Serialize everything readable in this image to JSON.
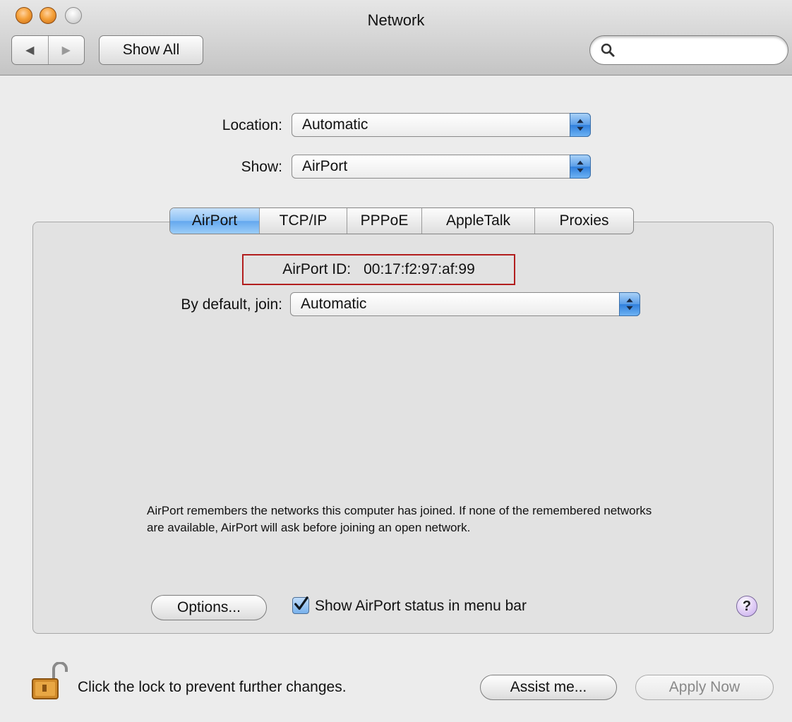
{
  "window": {
    "title": "Network"
  },
  "toolbar": {
    "back_icon": "back-arrow-icon",
    "forward_icon": "forward-arrow-icon",
    "show_all_label": "Show All",
    "search_placeholder": ""
  },
  "location": {
    "label": "Location:",
    "value": "Automatic"
  },
  "show": {
    "label": "Show:",
    "value": "AirPort"
  },
  "tabs": [
    {
      "label": "AirPort",
      "active": true
    },
    {
      "label": "TCP/IP",
      "active": false
    },
    {
      "label": "PPPoE",
      "active": false
    },
    {
      "label": "AppleTalk",
      "active": false
    },
    {
      "label": "Proxies",
      "active": false
    }
  ],
  "airport": {
    "id_label": "AirPort ID:",
    "id_value": "00:17:f2:97:af:99",
    "join_label": "By default, join:",
    "join_value": "Automatic",
    "description": "AirPort remembers the networks this computer has joined. If none of the remembered networks are available, AirPort will ask before joining an open network.",
    "options_label": "Options...",
    "status_checkbox_label": "Show AirPort status in menu bar",
    "status_checkbox_checked": true,
    "help_label": "?"
  },
  "footer": {
    "lock_text": "Click the lock to prevent further changes.",
    "assist_label": "Assist me...",
    "apply_label": "Apply Now"
  },
  "colors": {
    "highlight_border": "#b21e1e",
    "accent_blue": "#5a9de8"
  }
}
